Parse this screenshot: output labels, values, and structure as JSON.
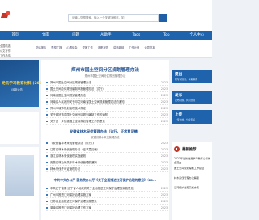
{
  "search": {
    "placeholder": "请输入您想搜索，输入一个关键字即可。如："
  },
  "nav": [
    "首页",
    "文库",
    "问题",
    "AI助手",
    "Tags",
    "Top",
    "个人中心"
  ],
  "sub": {
    "left": [
      "全国精选",
      "公文写作",
      "工作总结"
    ],
    "links": [
      "总结报告",
      "思想汇报",
      "心得体会",
      "党团工作",
      "述职报告",
      "讲话致辞",
      "工作计划",
      "合同范本"
    ]
  },
  "left_banner": {
    "title": "党员学习教育材料 (2023—20",
    "sub": "(最新公告)"
  },
  "main": {
    "title": "郑州市国土空间分区规划管理办法",
    "subtitle": "郑州市国土空间分区规划管理办法",
    "list1": [
      {
        "t": "郑州市国土空间分区规划管理办法",
        "d": "2023"
      },
      {
        "t": "国土空间总体规划编制审批管理办法（试行）",
        "d": "2023"
      },
      {
        "t": "河南省国土空间规划管理办法",
        "d": "2023"
      },
      {
        "t": "河南省人民政府关于印发河南省国土空间规划管理办法的通知",
        "d": "2023"
      },
      {
        "t": "郑州市城市规划管理技术规定",
        "d": "2023"
      },
      {
        "t": "关于做好市县国土空间分区规划编制工作的通知",
        "d": "2023"
      },
      {
        "t": "关于进一步加强国土空间规划管理工作的意见",
        "d": "2023"
      }
    ],
    "section2": {
      "title": "安徽省林木采伐管理办法（试行，征求意见稿）",
      "sub": "安徽省林木采伐管理办法"
    },
    "list2": [
      {
        "t": "《安徽省林木采伐管理办法（试行）》",
        "d": "2023"
      },
      {
        "t": "江苏省林木采伐管理办法（征求意见稿）",
        "d": "2023"
      },
      {
        "t": "浙江省林木采伐管理实施细则",
        "d": "2023"
      },
      {
        "t": "安徽省林业局关于林木采伐管理的通知",
        "d": "2023"
      },
      {
        "t": "林木采伐许可证管理办法",
        "d": "2023"
      }
    ],
    "section3": {
      "title": "中共中央办公厅 国务院办公厅《关于全面推进江河保护治理的意见》（20..."
    },
    "list3": [
      {
        "t": "中共辽宁省委 辽宁省人民政府关于全面推进江河保护治理的实施意见",
        "d": "2023"
      },
      {
        "t": "广州市推进江河保护治理实施方案",
        "d": "2023"
      },
      {
        "t": "江苏省全面推进江河保护治理实施意见",
        "d": "2023"
      },
      {
        "t": "湖南省推进江河保护治理工作方案",
        "d": "2023"
      }
    ]
  },
  "right": {
    "buttons": [
      {
        "label": "提出",
        "sub": "向专家提问，获取解答"
      },
      {
        "label": "发布",
        "sub": "发布问题，共同交流"
      },
      {
        "label": "上传",
        "sub": "上传文档，分享知识"
      }
    ],
    "news_title": "最新推荐",
    "news": [
      "2023年最新党员学习教育心得体会范文",
      "国土空间规划编制工作总结",
      "林木采伐管理办法解读",
      "江河保护治理实施方案"
    ]
  }
}
